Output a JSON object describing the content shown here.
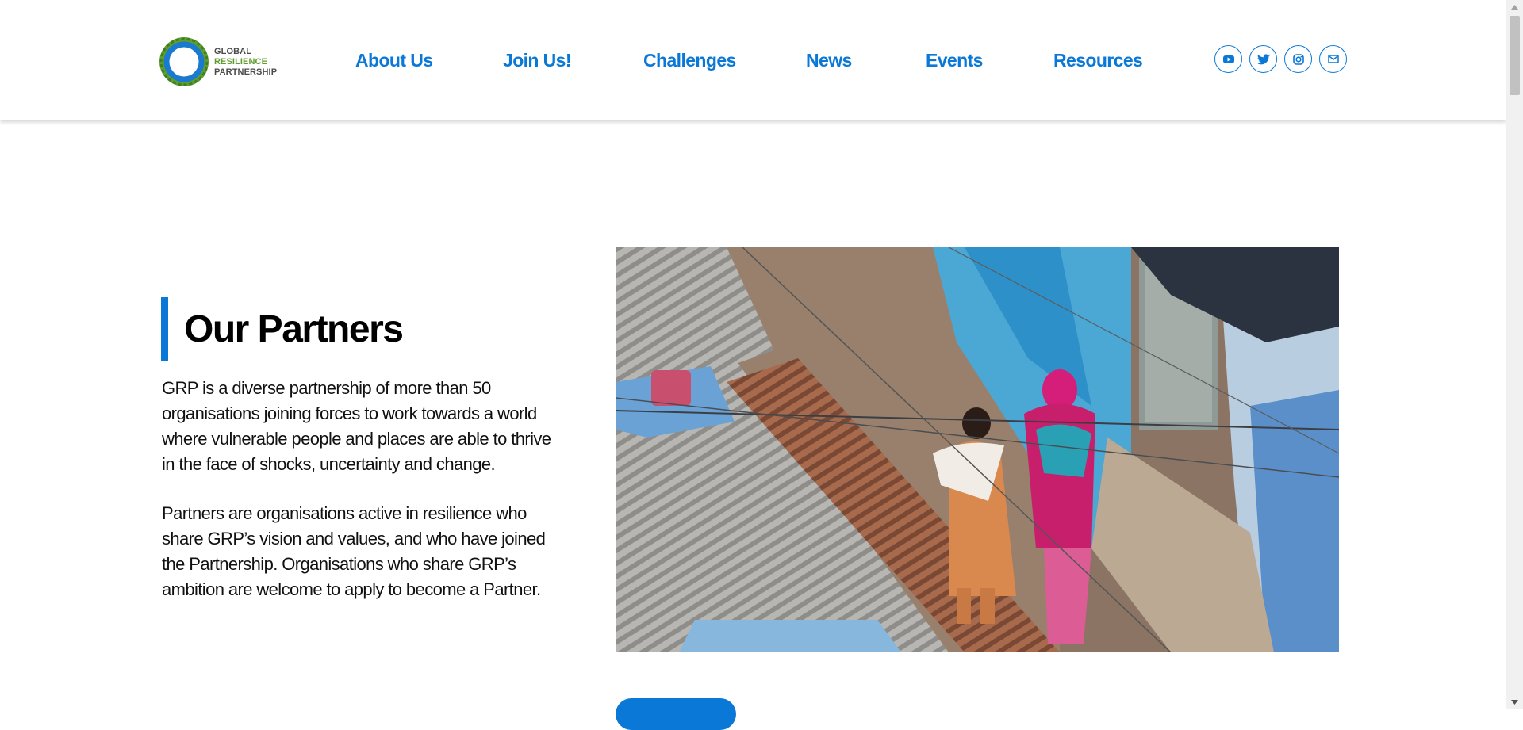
{
  "header": {
    "logo": {
      "line1": "GLOBAL",
      "line2": "RESILIENCE",
      "line3": "PARTNERSHIP"
    },
    "nav": [
      {
        "label": "About Us"
      },
      {
        "label": "Join Us!"
      },
      {
        "label": "Challenges"
      },
      {
        "label": "News"
      },
      {
        "label": "Events"
      },
      {
        "label": "Resources"
      }
    ],
    "social": [
      {
        "icon": "youtube-icon"
      },
      {
        "icon": "twitter-icon"
      },
      {
        "icon": "instagram-icon"
      },
      {
        "icon": "email-icon"
      }
    ]
  },
  "main": {
    "title": "Our Partners",
    "paragraph1": "GRP is a diverse partnership of more than 50 organisations joining forces to work towards a world where vulnerable people and places are able to thrive in the face of shocks, uncertainty and change.",
    "paragraph2": "Partners are organisations active in resilience who share GRP’s vision and values, and who have joined the Partnership. Organisations who share GRP’s ambition are welcome to apply to become a Partner.",
    "photo": "women-walking-in-alley-photo"
  },
  "colors": {
    "accent": "#0a78d6",
    "logo_green": "#5f9d2e",
    "text": "#111111"
  }
}
